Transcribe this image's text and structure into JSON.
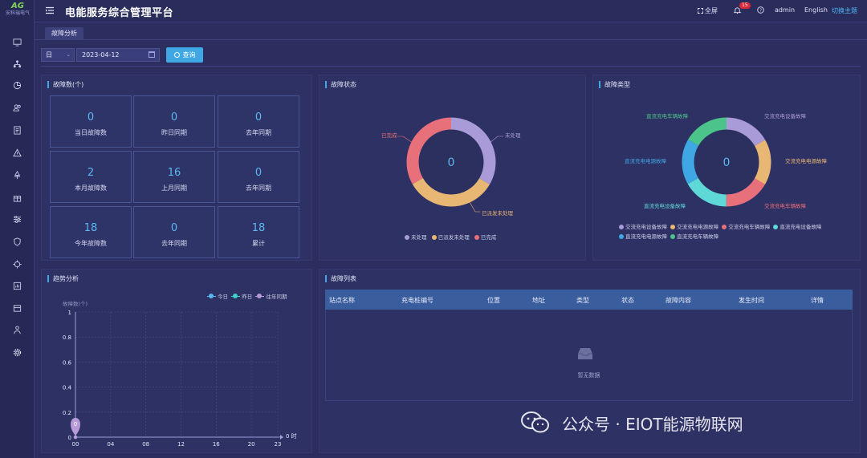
{
  "app": {
    "logo_mark": "AG",
    "logo_text": "安科瑞电气",
    "title": "电能服务综合管理平台"
  },
  "topbar": {
    "fullscreen": "全屏",
    "notify_count": "15",
    "user": "admin",
    "lang": "English",
    "theme": "切换主题"
  },
  "sidebar": {
    "items": [
      "monitor-icon",
      "topology-icon",
      "pie-icon",
      "users-icon",
      "document-icon",
      "warning-icon",
      "station-icon",
      "gift-icon",
      "settings-sliders-icon",
      "shield-icon",
      "target-icon",
      "report-icon",
      "card-icon",
      "org-icon",
      "gear-icon"
    ]
  },
  "tab": {
    "label": "故障分析"
  },
  "filter": {
    "period": "日",
    "date": "2023-04-12",
    "query": "查询"
  },
  "fault_count": {
    "title": "故障数(个)",
    "cards": [
      {
        "value": "0",
        "label": "当日故障数"
      },
      {
        "value": "0",
        "label": "昨日同期"
      },
      {
        "value": "0",
        "label": "去年同期"
      },
      {
        "value": "2",
        "label": "本月故障数"
      },
      {
        "value": "16",
        "label": "上月同期"
      },
      {
        "value": "0",
        "label": "去年同期"
      },
      {
        "value": "18",
        "label": "今年故障数"
      },
      {
        "value": "0",
        "label": "去年同期"
      },
      {
        "value": "18",
        "label": "累计"
      }
    ]
  },
  "fault_status": {
    "title": "故障状态",
    "center": "0",
    "labels": {
      "completed": "已完成",
      "unhandled": "未处理",
      "dispatched": "已派发未处理"
    },
    "legend": [
      "未处理",
      "已派发未处理",
      "已完成"
    ],
    "colors": [
      "#a99ad8",
      "#e9b774",
      "#e8707a"
    ]
  },
  "fault_type": {
    "title": "故障类型",
    "center": "0",
    "labels": {
      "dc_vehicle": "直流充电车辆故障",
      "ac_device": "交流充电设备故障",
      "dc_power": "直流充电电源故障",
      "ac_power": "交流充电电源故障",
      "dc_device": "直流充电设备故障",
      "ac_vehicle": "交流充电车辆故障"
    },
    "legend": [
      "交流充电设备故障",
      "交流充电电源故障",
      "交流充电车辆故障",
      "直流充电设备故障",
      "直流充电电源故障",
      "直流充电车辆故障"
    ],
    "colors": [
      "#a99ad8",
      "#e9b774",
      "#e8707a",
      "#5fd8d8",
      "#3fa7e3",
      "#4cc38a"
    ]
  },
  "trend": {
    "title": "趋势分析",
    "ylabel": "故障数(个)",
    "legend": [
      "今日",
      "昨日",
      "往年同期"
    ],
    "legend_colors": [
      "#5ab8f0",
      "#3fd0c8",
      "#b79ad8"
    ],
    "y_ticks": [
      "1",
      "0.8",
      "0.6",
      "0.4",
      "0.2",
      "0"
    ],
    "x_ticks": [
      "00",
      "04",
      "08",
      "12",
      "16",
      "20",
      "23"
    ],
    "x_unit": "时",
    "marker_value": "0"
  },
  "chart_data": {
    "type": "line",
    "ylabel": "故障数(个)",
    "x": [
      "00",
      "04",
      "08",
      "12",
      "16",
      "20",
      "23"
    ],
    "series": [
      {
        "name": "今日",
        "values": [
          0
        ]
      },
      {
        "name": "昨日",
        "values": [
          0
        ]
      },
      {
        "name": "往年同期",
        "values": [
          0
        ]
      }
    ],
    "ylim": [
      0,
      1
    ],
    "grid": true,
    "legend_position": "top-right"
  },
  "fault_list": {
    "title": "故障列表",
    "columns": [
      "站点名称",
      "充电桩编号",
      "位置",
      "地址",
      "类型",
      "状态",
      "故障内容",
      "发生时间",
      "详情"
    ],
    "rows": [],
    "empty": "暂无数据"
  },
  "watermark": {
    "text": "公众号 · EIOT能源物联网"
  }
}
